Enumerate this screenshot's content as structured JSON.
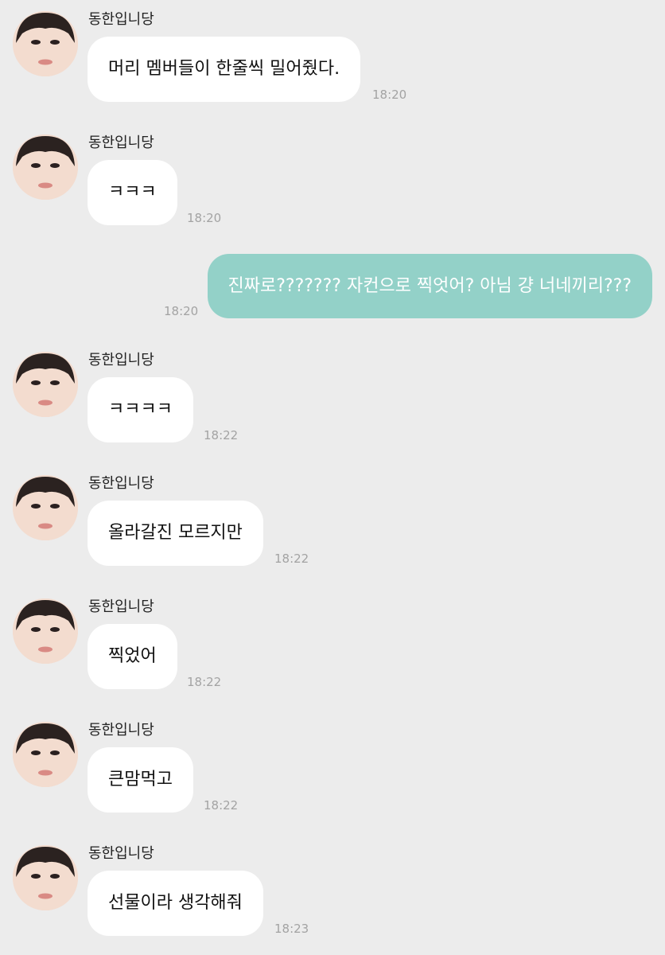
{
  "messages": [
    {
      "sender": "동한입니당",
      "text": "머리 멤버들이 한줄씩 밀어줬다.",
      "time": "18:20"
    },
    {
      "sender": "동한입니당",
      "text": "ㅋㅋㅋ",
      "time": "18:20"
    },
    {
      "text": "진짜로??????? 자컨으로 찍엇어? 아님 걍 너네끼리???",
      "time": "18:20"
    },
    {
      "sender": "동한입니당",
      "text": "ㅋㅋㅋㅋ",
      "time": "18:22"
    },
    {
      "sender": "동한입니당",
      "text": "올라갈진 모르지만",
      "time": "18:22"
    },
    {
      "sender": "동한입니당",
      "text": "찍었어",
      "time": "18:22"
    },
    {
      "sender": "동한입니당",
      "text": "큰맘먹고",
      "time": "18:22"
    },
    {
      "sender": "동한입니당",
      "text": "선물이라 생각해줘",
      "time": "18:23"
    }
  ],
  "colors": {
    "background": "#ececec",
    "incoming_bubble": "#ffffff",
    "outgoing_bubble": "#93d1c8",
    "timestamp": "#a3a3a3"
  },
  "icons": {
    "avatar": "avatar-icon"
  }
}
